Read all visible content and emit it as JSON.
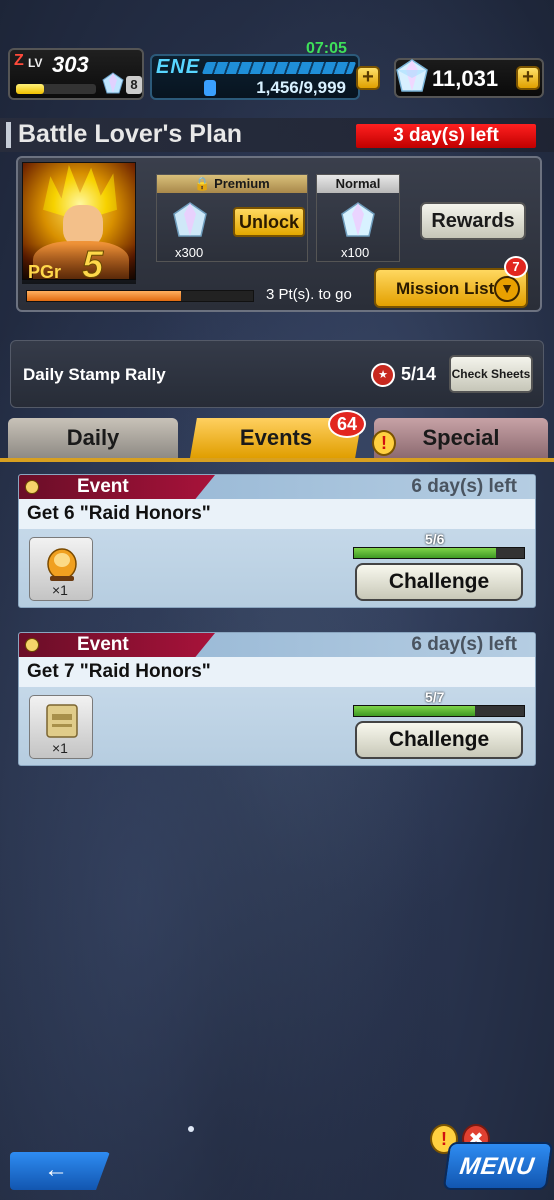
{
  "hud": {
    "level_prefix": "LV",
    "level": "303",
    "level_badge": "Z",
    "energy_label": "ENE",
    "energy_timer": "07:05",
    "energy_value": "1,456/9,999",
    "crystals": "11,031",
    "plus_symbol": "+"
  },
  "plan": {
    "title": "Battle Lover's Plan",
    "days_left": "3 day(s) left",
    "premium_label": "Premium",
    "premium_qty": "x300",
    "unlock_label": "Unlock",
    "normal_label": "Normal",
    "normal_qty": "x100",
    "rewards_label": "Rewards",
    "pgr_label": "PGr",
    "pgr_value": "5",
    "progress_text": "3 Pt(s). to go",
    "progress_fraction": 0.68,
    "mission_list_label": "Mission List",
    "mission_list_badge": "7"
  },
  "stamp_rally": {
    "title": "Daily Stamp Rally",
    "count": "5/14",
    "check_label": "Check Sheets"
  },
  "tabs": {
    "daily": "Daily",
    "events": "Events",
    "events_badge": "64",
    "special": "Special",
    "active": "Events"
  },
  "missions": [
    {
      "tag": "Event",
      "days_left": "6 day(s) left",
      "title": "Get 6 \"Raid Honors\"",
      "reward_icon": "capsule-icon",
      "reward_qty": "×1",
      "progress": "5/6",
      "progress_fraction": 0.833,
      "button": "Challenge"
    },
    {
      "tag": "Event",
      "days_left": "6 day(s) left",
      "title": "Get 7 \"Raid Honors\"",
      "reward_icon": "ticket-icon",
      "reward_qty": "×1",
      "progress": "5/7",
      "progress_fraction": 0.714,
      "button": "Challenge"
    }
  ],
  "bottom": {
    "back_arrow": "←",
    "menu_label": "MENU",
    "alert_symbol": "!"
  },
  "colors": {
    "accent_gold": "#e3a800",
    "alert_red": "#e2261f",
    "progress_green": "#3e9a24",
    "nav_blue": "#1256b0"
  }
}
